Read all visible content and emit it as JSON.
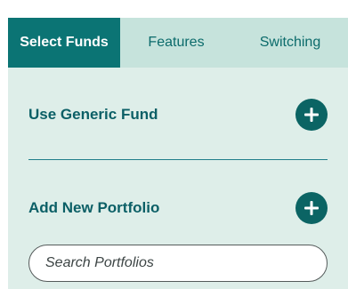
{
  "tabs": [
    {
      "label": "Select Funds",
      "active": true
    },
    {
      "label": "Features",
      "active": false
    },
    {
      "label": "Switching",
      "active": false
    }
  ],
  "generic_fund": {
    "label": "Use Generic Fund",
    "button_icon": "plus-icon"
  },
  "portfolio": {
    "label": "Add New Portfolio",
    "button_icon": "plus-icon"
  },
  "search": {
    "value": "",
    "placeholder": "Search Portfolios"
  },
  "colors": {
    "accent": "#0b7474",
    "panel_bg": "#deeee9",
    "tab_bar_bg": "#c6e3dc",
    "text_primary": "#0b5f66"
  }
}
